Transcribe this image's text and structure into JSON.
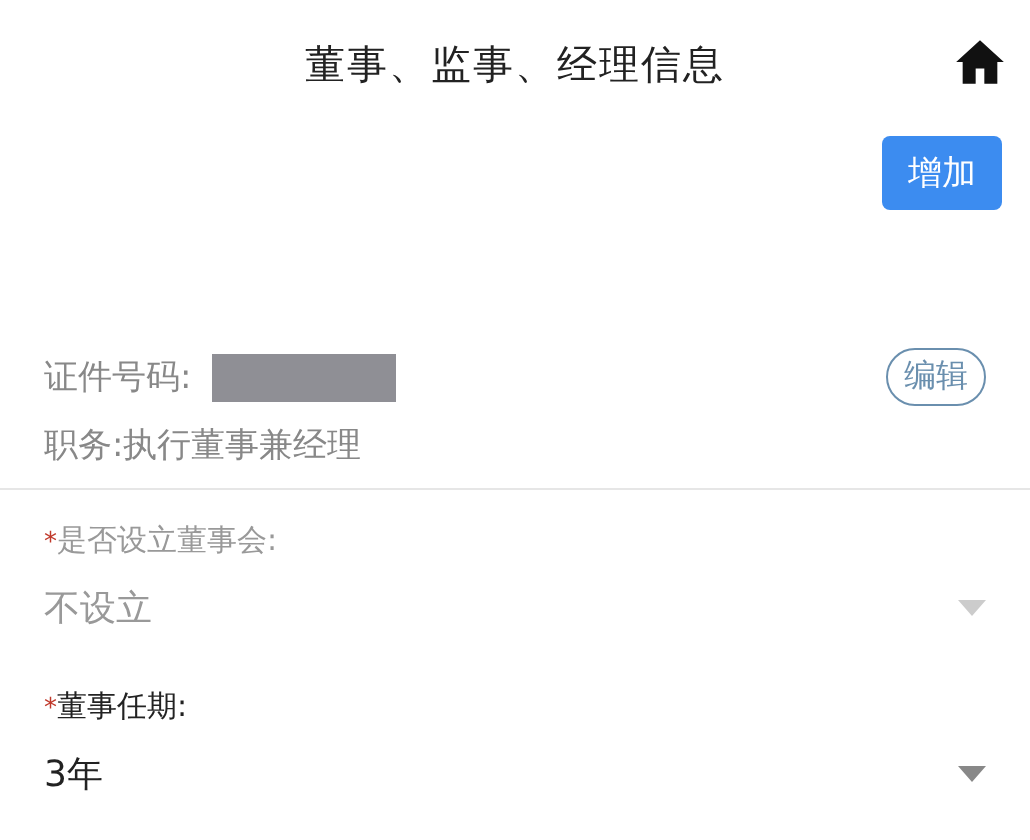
{
  "header": {
    "title": "董事、监事、经理信息"
  },
  "add_button": "增加",
  "person": {
    "id_label": "证件号码:",
    "id_redacted": true,
    "position": "职务:执行董事兼经理",
    "edit_button": "编辑"
  },
  "fields": [
    {
      "required_mark": "*",
      "label": "是否设立董事会:",
      "value": "不设立",
      "disabled": true
    },
    {
      "required_mark": "*",
      "label": "董事任期:",
      "value": "3年",
      "disabled": false
    }
  ]
}
